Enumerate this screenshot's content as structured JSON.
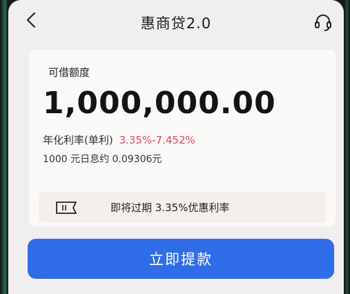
{
  "header": {
    "title": "惠商贷2.0"
  },
  "card": {
    "limit_label": "可借额度",
    "amount": "1,000,000.00",
    "rate_label": "年化利率(单利)",
    "rate_value": "3.35%-7.452%",
    "interest_text": "1000 元日息约 0.09306元"
  },
  "promo": {
    "text": "即将过期 3.35%优惠利率"
  },
  "actions": {
    "withdraw_label": "立即提款"
  },
  "colors": {
    "accent_button": "#2f6de8",
    "rate_highlight": "#d94a5a"
  },
  "icons": [
    "back-arrow",
    "headset",
    "ticket"
  ]
}
